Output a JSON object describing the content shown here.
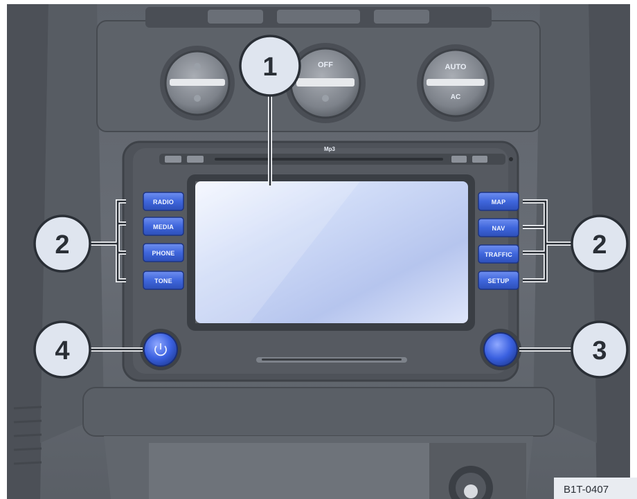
{
  "unit_buttons_left": [
    "RADIO",
    "MEDIA",
    "PHONE",
    "TONE"
  ],
  "unit_buttons_right": [
    "MAP",
    "NAV",
    "TRAFFIC",
    "SETUP"
  ],
  "callouts": {
    "display": "1",
    "buttons_left": "2",
    "buttons_right": "2",
    "knob_right": "3",
    "knob_left": "4"
  },
  "climate": {
    "center_label": "OFF",
    "right_top_label": "AUTO",
    "right_bottom_label": "AC"
  },
  "slot_label": "Mp3",
  "figure_ref": "B1T-0407",
  "colors": {
    "accent_blue": "#3b62d6",
    "callout_fill": "#dfe5ef",
    "dash_gray": "#6b7079"
  }
}
